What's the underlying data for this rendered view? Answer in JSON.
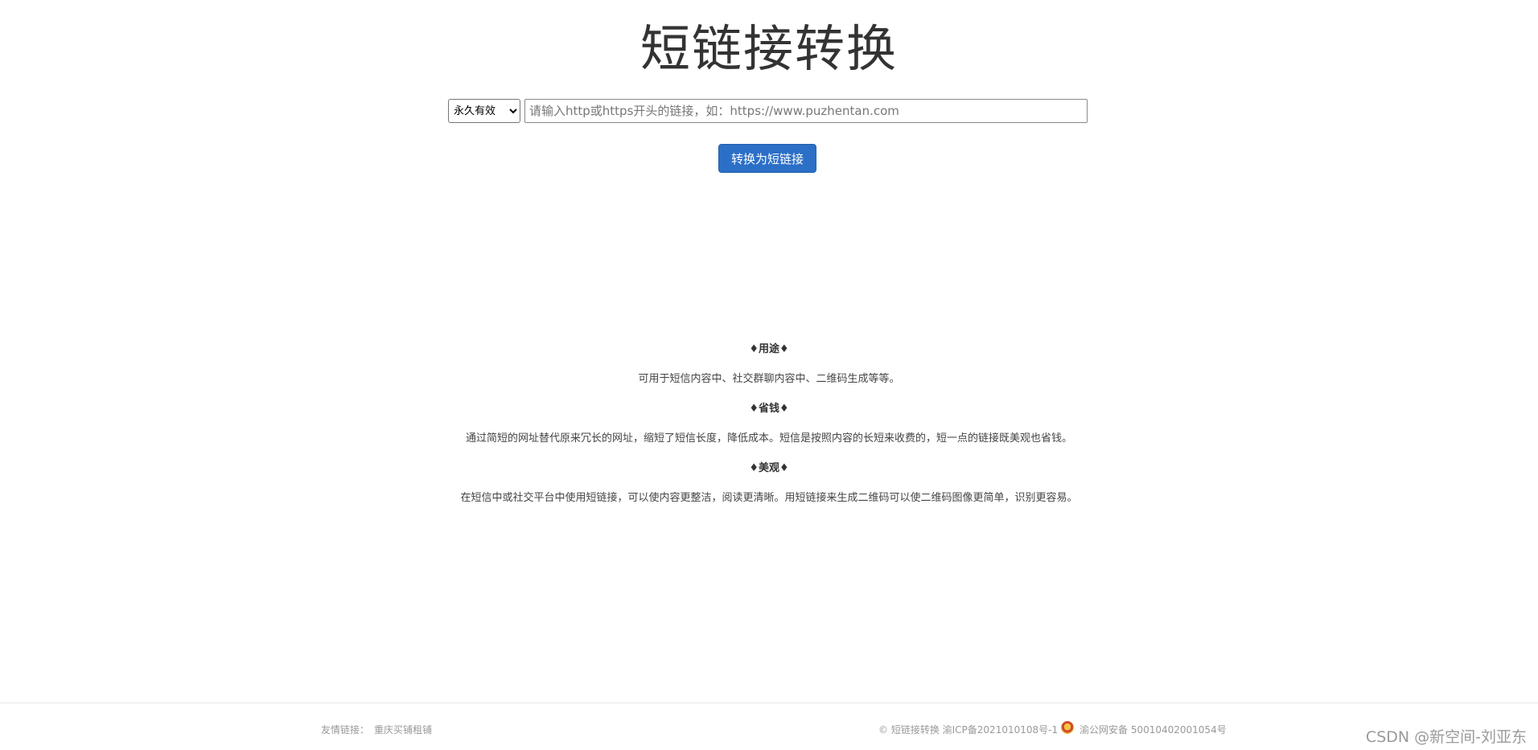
{
  "header": {
    "title": "短链接转换"
  },
  "form": {
    "expire_selected": "永久有效",
    "url_value": "",
    "url_placeholder": "请输入http或https开头的链接，如：https://www.puzhentan.com",
    "convert_label": "转换为短链接"
  },
  "features": [
    {
      "heading": "♦用途♦",
      "text": "可用于短信内容中、社交群聊内容中、二维码生成等等。"
    },
    {
      "heading": "♦省钱♦",
      "text": "通过简短的网址替代原来冗长的网址，缩短了短信长度，降低成本。短信是按照内容的长短来收费的，短一点的链接既美观也省钱。"
    },
    {
      "heading": "♦美观♦",
      "text": "在短信中或社交平台中使用短链接，可以使内容更整洁，阅读更清晰。用短链接来生成二维码可以使二维码图像更简单，识别更容易。"
    }
  ],
  "footer": {
    "friend_links_label": "友情链接：",
    "friend_links": [
      "重庆买铺租铺"
    ],
    "copyright": "© 短链接转换 渝ICP备2021010108号-1",
    "police_record": "渝公网安备 50010402001054号"
  },
  "watermark": "CSDN @新空间-刘亚东",
  "colors": {
    "primary_button": "#2b6fc7",
    "footer_text": "#999999"
  },
  "icons": {
    "police_badge": "police-badge-icon"
  }
}
